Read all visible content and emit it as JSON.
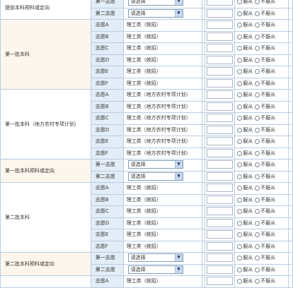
{
  "options": {
    "agree": "服从",
    "disagree": "不服从"
  },
  "groups": [
    {
      "title": "提前本科预科或定向",
      "kind": "select",
      "rows": [
        {
          "label": "第一志愿",
          "value": "请选择"
        },
        {
          "label": "第二志愿",
          "value": "请选择"
        }
      ]
    },
    {
      "title": "第一批本科",
      "kind": "major",
      "rows": [
        {
          "label": "志愿A",
          "value": "理工类（统招）"
        },
        {
          "label": "志愿B",
          "value": "理工类（统招）"
        },
        {
          "label": "志愿C",
          "value": "理工类（统招）"
        },
        {
          "label": "志愿D",
          "value": "理工类（统招）"
        },
        {
          "label": "志愿E",
          "value": "理工类（统招）"
        },
        {
          "label": "志愿F",
          "value": "理工类（统招）"
        }
      ]
    },
    {
      "title": "第一批本科（地方农村专项计划）",
      "kind": "major",
      "rows": [
        {
          "label": "志愿A",
          "value": "理工类（地方农村专项计划）"
        },
        {
          "label": "志愿B",
          "value": "理工类（地方农村专项计划）"
        },
        {
          "label": "志愿C",
          "value": "理工类（地方农村专项计划）"
        },
        {
          "label": "志愿D",
          "value": "理工类（地方农村专项计划）"
        },
        {
          "label": "志愿E",
          "value": "理工类（地方农村专项计划）"
        },
        {
          "label": "志愿F",
          "value": "理工类（地方农村专项计划）"
        }
      ]
    },
    {
      "title": "第一批本科预科或定向",
      "kind": "select",
      "rows": [
        {
          "label": "第一志愿",
          "value": "请选择"
        },
        {
          "label": "第二志愿",
          "value": "请选择"
        }
      ]
    },
    {
      "title": "第二批本科",
      "kind": "major",
      "rows": [
        {
          "label": "志愿A",
          "value": "理工类（统招）"
        },
        {
          "label": "志愿B",
          "value": "理工类（统招）"
        },
        {
          "label": "志愿C",
          "value": "理工类（统招）"
        },
        {
          "label": "志愿D",
          "value": "理工类（统招）"
        },
        {
          "label": "志愿E",
          "value": "理工类（统招）"
        },
        {
          "label": "志愿F",
          "value": "理工类（统招）"
        }
      ]
    },
    {
      "title": "第二批本科预科或定向",
      "kind": "select",
      "rows": [
        {
          "label": "第一志愿",
          "value": "请选择"
        },
        {
          "label": "第二志愿",
          "value": "请选择"
        }
      ]
    },
    {
      "title": "",
      "kind": "major",
      "rows": [
        {
          "label": "志愿A",
          "value": "理工类（统招）"
        }
      ]
    }
  ]
}
